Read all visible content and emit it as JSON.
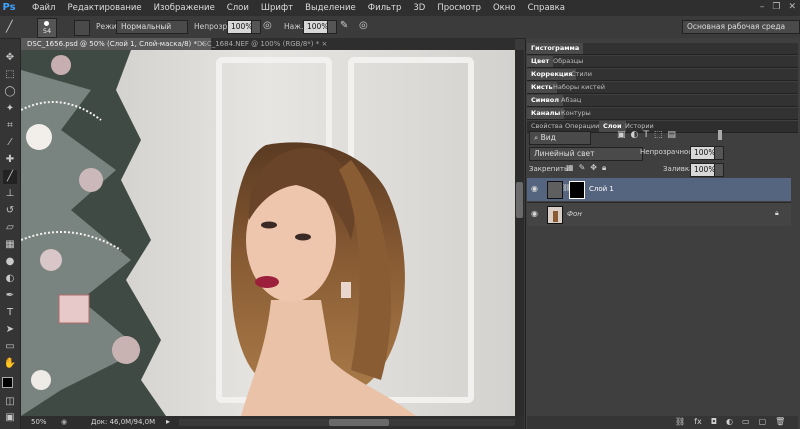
{
  "app": {
    "logo": "Ps",
    "window_controls": [
      "–",
      "❐",
      "✕"
    ]
  },
  "menu": [
    "Файл",
    "Редактирование",
    "Изображение",
    "Слои",
    "Шрифт",
    "Выделение",
    "Фильтр",
    "3D",
    "Просмотр",
    "Окно",
    "Справка"
  ],
  "options": {
    "brush_size": "54",
    "mode_label": "Режим:",
    "mode_value": "Нормальный",
    "opacity_label": "Непрозр.:",
    "opacity_value": "100%",
    "flow_label": "Наж.:",
    "flow_value": "100%",
    "workspace": "Основная рабочая среда"
  },
  "tabs": [
    {
      "label": "DSC_1656.psd @ 50% (Слой 1, Слой-маска/8) *",
      "active": true
    },
    {
      "label": "DSC_1684.NEF @ 100% (RGB/8*) *",
      "active": false
    }
  ],
  "status": {
    "zoom": "50%",
    "doc": "Док: 46,0M/94,0M"
  },
  "panels": {
    "row1": [
      "Гистограмма"
    ],
    "row2": [
      "Цвет",
      "Образцы"
    ],
    "row3": [
      "Коррекция",
      "Стили"
    ],
    "row4": [
      "Кисть",
      "Наборы кистей"
    ],
    "row5": [
      "Символ",
      "Абзац"
    ],
    "row6": [
      "Каналы",
      "Контуры"
    ],
    "row7": [
      "Свойства",
      "Операции",
      "Слои",
      "Истории"
    ]
  },
  "layers_panel": {
    "filter_kind": "Вид",
    "blend_mode": "Линейный свет",
    "opacity_label": "Непрозрачность:",
    "opacity_value": "100%",
    "lock_label": "Закрепить:",
    "fill_label": "Заливка:",
    "fill_value": "100%",
    "layers": [
      {
        "name": "Слой 1",
        "selected": true
      },
      {
        "name": "Фон",
        "selected": false
      }
    ]
  },
  "colors": {
    "accent": "#3fa2ff",
    "selected_layer": "#55657f"
  }
}
